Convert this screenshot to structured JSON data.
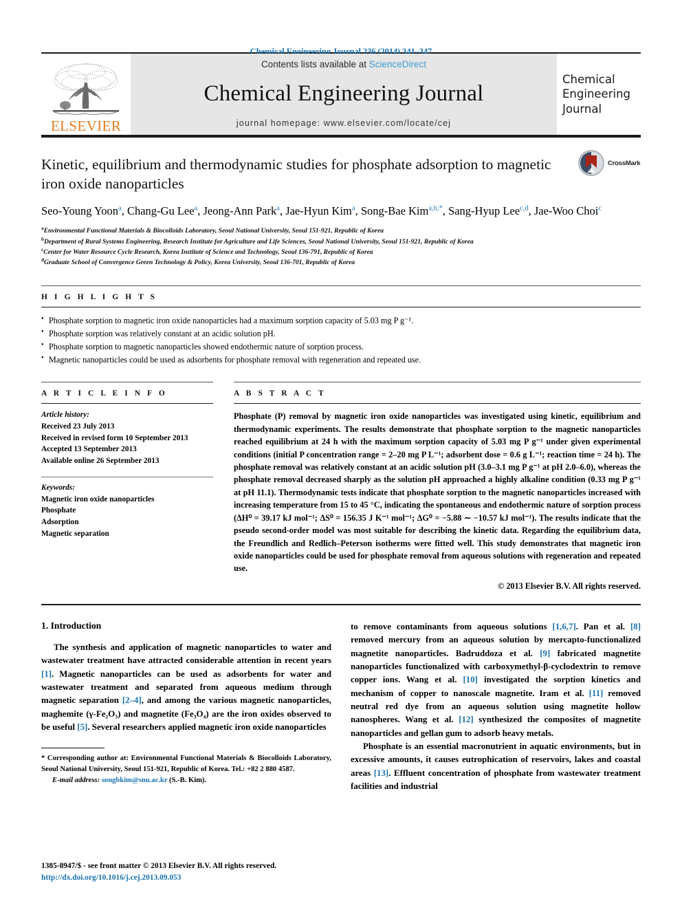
{
  "running_head": "Chemical Engineering Journal 236 (2014) 341–347",
  "masthead": {
    "contents_prefix": "Contents lists available at ",
    "sciencedirect": "ScienceDirect",
    "journal_name": "Chemical Engineering Journal",
    "homepage": "journal homepage: www.elsevier.com/locate/cej",
    "publisher_wordmark": "ELSEVIER",
    "cover_title_line1": "Chemical",
    "cover_title_line2": "Engineering",
    "cover_title_line3": "Journal",
    "link_color": "#3d9bd4",
    "elsevier_orange": "#e87b1e"
  },
  "article": {
    "title": "Kinetic, equilibrium and thermodynamic studies for phosphate adsorption to magnetic iron oxide nanoparticles",
    "crossmark_label": "CrossMark",
    "authors": [
      {
        "name": "Seo-Young Yoon",
        "sup": "a",
        "sep": ", "
      },
      {
        "name": "Chang-Gu Lee",
        "sup": "a",
        "sep": ", "
      },
      {
        "name": "Jeong-Ann Park",
        "sup": "a",
        "sep": ", "
      },
      {
        "name": "Jae-Hyun Kim",
        "sup": "a",
        "sep": ", "
      },
      {
        "name": "Song-Bae Kim",
        "sup": "a,b,*",
        "sep": ", "
      },
      {
        "name": "Sang-Hyup Lee",
        "sup": "c,d",
        "sep": ", "
      },
      {
        "name": "Jae-Woo Choi",
        "sup": "c",
        "sep": ""
      }
    ],
    "affiliations": [
      {
        "mark": "a",
        "text": "Environmental Functional Materials & Biocolloids Laboratory, Seoul National University, Seoul 151-921, Republic of Korea"
      },
      {
        "mark": "b",
        "text": "Department of Rural Systems Engineering, Research Institute for Agriculture and Life Sciences, Seoul National University, Seoul 151-921, Republic of Korea"
      },
      {
        "mark": "c",
        "text": "Center for Water Resource Cycle Research, Korea Institute of Science and Technology, Seoul 136-791, Republic of Korea"
      },
      {
        "mark": "d",
        "text": "Graduate School of Convergence Green Technology & Policy, Korea University, Seoul 136-701, Republic of Korea"
      }
    ]
  },
  "highlights": {
    "heading": "H I G H L I G H T S",
    "items": [
      "Phosphate sorption to magnetic iron oxide nanoparticles had a maximum sorption capacity of 5.03 mg P g⁻¹.",
      "Phosphate sorption was relatively constant at an acidic solution pH.",
      "Phosphate sorption to magnetic nanoparticles showed endothermic nature of sorption process.",
      "Magnetic nanoparticles could be used as adsorbents for phosphate removal with regeneration and repeated use."
    ]
  },
  "article_info": {
    "heading": "A R T I C L E   I N F O",
    "history_label": "Article history:",
    "history": [
      "Received 23 July 2013",
      "Received in revised form 10 September 2013",
      "Accepted 13 September 2013",
      "Available online 26 September 2013"
    ],
    "keywords_label": "Keywords:",
    "keywords": [
      "Magnetic iron oxide nanoparticles",
      "Phosphate",
      "Adsorption",
      "Magnetic separation"
    ]
  },
  "abstract": {
    "heading": "A B S T R A C T",
    "text": "Phosphate (P) removal by magnetic iron oxide nanoparticles was investigated using kinetic, equilibrium and thermodynamic experiments. The results demonstrate that phosphate sorption to the magnetic nanoparticles reached equilibrium at 24 h with the maximum sorption capacity of 5.03 mg P g⁻¹ under given experimental conditions (initial P concentration range = 2–20 mg P L⁻¹; adsorbent dose = 0.6 g L⁻¹; reaction time = 24 h). The phosphate removal was relatively constant at an acidic solution pH (3.0–3.1 mg P g⁻¹ at pH 2.0–6.0), whereas the phosphate removal decreased sharply as the solution pH approached a highly alkaline condition (0.33 mg P g⁻¹ at pH 11.1). Thermodynamic tests indicate that phosphate sorption to the magnetic nanoparticles increased with increasing temperature from 15 to 45 °C, indicating the spontaneous and endothermic nature of sorption process (ΔH⁰ = 39.17 kJ mol⁻¹; ΔS⁰ = 156.35 J K⁻¹ mol⁻¹; ΔG⁰ = −5.88 ∼ −10.57 kJ mol⁻¹). The results indicate that the pseudo second-order model was most suitable for describing the kinetic data. Regarding the equilibrium data, the Freundlich and Redlich–Peterson isotherms were fitted well. This study demonstrates that magnetic iron oxide nanoparticles could be used for phosphate removal from aqueous solutions with regeneration and repeated use.",
    "copyright": "© 2013 Elsevier B.V. All rights reserved."
  },
  "body": {
    "section_title": "1. Introduction",
    "left_paragraph_1_a": "The synthesis and application of magnetic nanoparticles to water and wastewater treatment have attracted considerable attention in recent years ",
    "left_ref_1": "[1]",
    "left_paragraph_1_b": ". Magnetic nanoparticles can be used as adsorbents for water and wastewater treatment and separated from aqueous medium through magnetic separation ",
    "left_ref_2": "[2–4]",
    "left_paragraph_1_c": ", and among the various magnetic nanoparticles, maghemite (γ-Fe₂O₃) and magnetite (Fe₃O₄) are the iron oxides observed to be useful ",
    "left_ref_3": "[5]",
    "left_paragraph_1_d": ". Several researchers applied magnetic iron oxide nanoparticles",
    "right_paragraph_1_a": "to remove contaminants from aqueous solutions ",
    "right_ref_1": "[1,6,7]",
    "right_paragraph_1_b": ". Pan et al. ",
    "right_ref_2": "[8]",
    "right_paragraph_1_c": " removed mercury from an aqueous solution by mercapto-functionalized magnetite nanoparticles. Badruddoza et al. ",
    "right_ref_3": "[9]",
    "right_paragraph_1_d": " fabricated magnetite nanoparticles functionalized with carboxymethyl-β-cyclodextrin to remove copper ions. Wang et al. ",
    "right_ref_4": "[10]",
    "right_paragraph_1_e": " investigated the sorption kinetics and mechanism of copper to nanoscale magnetite. Iram et al. ",
    "right_ref_5": "[11]",
    "right_paragraph_1_f": " removed neutral red dye from an aqueous solution using magnetite hollow nanospheres. Wang et al. ",
    "right_ref_6": "[12]",
    "right_paragraph_1_g": " synthesized the composites of magnetite nanoparticles and gellan gum to adsorb heavy metals.",
    "right_paragraph_2_a": "Phosphate is an essential macronutrient in aquatic environments, but in excessive amounts, it causes eutrophication of reservoirs, lakes and coastal areas ",
    "right_ref_7": "[13]",
    "right_paragraph_2_b": ". Effluent concentration of phosphate from wastewater treatment facilities and industrial"
  },
  "footnote": {
    "star": "*",
    "text": " Corresponding author at: Environmental Functional Materials & Biocolloids Laboratory, Seoul National University, Seoul 151-921, Republic of Korea. Tel.: +82 2 880 4587.",
    "email_label": "E-mail address:",
    "email": "songbkim@snu.ac.kr",
    "email_suffix": " (S.-B. Kim)."
  },
  "page_footer": {
    "issn_line": "1385-8947/$ - see front matter © 2013 Elsevier B.V. All rights reserved.",
    "doi": "http://dx.doi.org/10.1016/j.cej.2013.09.053"
  }
}
